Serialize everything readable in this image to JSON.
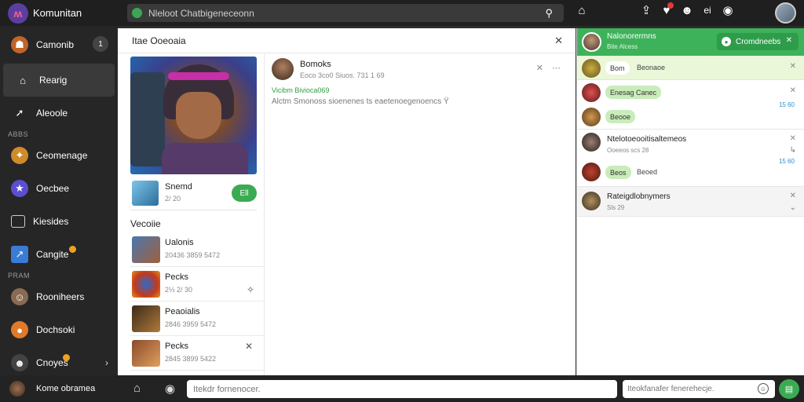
{
  "app": {
    "title": "Komunitan",
    "logo_glyph": "ʍ"
  },
  "search": {
    "text": "Nleloot Chatbigeneceonn",
    "right_icon": "user-icon"
  },
  "topbar": {
    "icons": [
      "home-icon",
      "upload-icon",
      "alert-icon",
      "profile-icon",
      "settings-icon"
    ],
    "profile_label": "ei"
  },
  "sidebar": {
    "items": [
      {
        "label": "Camonib",
        "icon": "community-icon",
        "count": "1"
      },
      {
        "label": "Rearig",
        "icon": "home-icon",
        "active": true
      },
      {
        "label": "Aleoole",
        "icon": "arrow-icon"
      },
      {
        "section": "ABBS"
      },
      {
        "label": "Ceomenage",
        "icon": "game-icon"
      },
      {
        "label": "Oecbee",
        "icon": "star-icon"
      },
      {
        "label": "Kiesides",
        "icon": "library-icon"
      },
      {
        "label": "Cangite",
        "icon": "tool-icon",
        "badge": true
      },
      {
        "section": "PRAM"
      },
      {
        "label": "Rooniheers",
        "icon": "avatar-icon"
      },
      {
        "label": "Dochsoki",
        "icon": "coin-icon"
      },
      {
        "label": "Cnoyes",
        "icon": "group-icon",
        "badge": true,
        "chevron": true
      }
    ]
  },
  "panel": {
    "title": "Itae Ooeoaia",
    "game": {
      "name": "Snemd",
      "sub": "2/ 20",
      "button": "Ell"
    },
    "section_title": "Vecoiie",
    "list": [
      {
        "name": "Ualonis",
        "sub": "20436 3859 5472"
      },
      {
        "name": "Pecks",
        "sub": "2⅓ 2/ 30"
      },
      {
        "name": "Peaoialis",
        "sub": "2846 3959 5472"
      },
      {
        "name": "Pecks",
        "sub": "2845 3899 5422"
      }
    ],
    "post": {
      "name": "Bomoks",
      "meta": "Eoco 3co0 Siuos. 731 1 69",
      "tag": "Vicibm Bivioca069",
      "text": "Alctm Smonoss sioenenes ts eaetenoegenoencs Ϋ"
    }
  },
  "chat": {
    "header": {
      "title": "Nalonorermns",
      "sub": "Bite Alcess",
      "button": "Cromdneebs"
    },
    "pinned": {
      "pill": "Bom",
      "text": "Beonaoe"
    },
    "threads": [
      {
        "pill1": "Enesag Canec",
        "pill2": "Beooe",
        "stat": "15 60"
      },
      {
        "name": "Ntelotoeooitisaltemeos",
        "sub": "Ooeeos scs 28",
        "pill": "Beos",
        "plain": "Beoed",
        "stat": "15 60"
      },
      {
        "name": "Rateigdlobnymers",
        "sub": "Sls 29"
      }
    ]
  },
  "bottom": {
    "profile": "Kome obramea",
    "input_placeholder": "Itekdr fornenocer.",
    "input2_placeholder": "Iteokfanafer fenerehecje."
  },
  "colors": {
    "accent": "#3bab52",
    "sidebar_bg": "#262626",
    "topbar_bg": "#1f1f1f"
  }
}
